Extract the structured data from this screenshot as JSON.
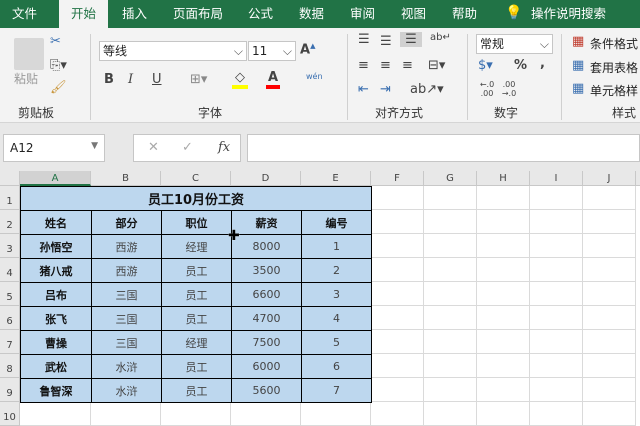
{
  "tabs": [
    "文件",
    "开始",
    "插入",
    "页面布局",
    "公式",
    "数据",
    "审阅",
    "视图",
    "帮助",
    "操作说明搜索"
  ],
  "ribbon": {
    "clipboard": {
      "paste": "粘贴",
      "label": "剪贴板"
    },
    "font": {
      "name": "等线",
      "size": "11",
      "bold": "B",
      "italic": "I",
      "underline": "U",
      "label": "字体",
      "fill_color": "#ffff00",
      "font_color": "#ff0000",
      "wen": "wén"
    },
    "alignment": {
      "label": "对齐方式"
    },
    "number": {
      "format": "常规",
      "percent": "%",
      "comma": ",",
      "inc": "←.0 .00",
      "dec": ".00 →.0",
      "label": "数字"
    },
    "styles": {
      "conditional": "条件格式",
      "table": "套用表格",
      "cell": "单元格样",
      "label": "样式"
    }
  },
  "formula_bar": {
    "name_box": "A12",
    "cancel": "✕",
    "enter": "✓",
    "fx": "fx",
    "value": ""
  },
  "columns": [
    "A",
    "B",
    "C",
    "D",
    "E",
    "F",
    "G",
    "H",
    "I",
    "J"
  ],
  "rows": [
    "1",
    "2",
    "3",
    "4",
    "5",
    "6",
    "7",
    "8",
    "9",
    "10"
  ],
  "sheet": {
    "title": "员工10月份工资",
    "headers": [
      "姓名",
      "部分",
      "职位",
      "薪资",
      "编号"
    ],
    "data": [
      [
        "孙悟空",
        "西游",
        "经理",
        "8000",
        "1"
      ],
      [
        "猪八戒",
        "西游",
        "员工",
        "3500",
        "2"
      ],
      [
        "吕布",
        "三国",
        "员工",
        "6600",
        "3"
      ],
      [
        "张飞",
        "三国",
        "员工",
        "4700",
        "4"
      ],
      [
        "曹操",
        "三国",
        "经理",
        "7500",
        "5"
      ],
      [
        "武松",
        "水浒",
        "员工",
        "6000",
        "6"
      ],
      [
        "鲁智深",
        "水浒",
        "员工",
        "5600",
        "7"
      ]
    ],
    "fill_color": "#bdd7ee"
  }
}
